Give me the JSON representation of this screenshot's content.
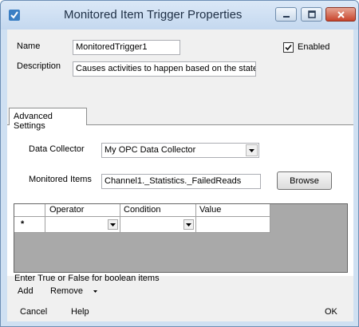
{
  "window": {
    "title": "Monitored Item Trigger Properties"
  },
  "form": {
    "name_label": "Name",
    "name_value": "MonitoredTrigger1",
    "enabled_label": "Enabled",
    "enabled_checked": true,
    "description_label": "Description",
    "description_value": "Causes activities to happen based on the state of a"
  },
  "tabs": [
    {
      "label": "Advanced Settings",
      "selected": true
    }
  ],
  "advanced": {
    "data_collector_label": "Data Collector",
    "data_collector_value": "My OPC Data Collector",
    "monitored_items_label": "Monitored Items",
    "monitored_items_value": "Channel1._Statistics._FailedReads",
    "browse_label": "Browse"
  },
  "grid": {
    "columns": [
      "Operator",
      "Condition",
      "Value"
    ],
    "new_row_marker": "*"
  },
  "hint": "Enter True or False for boolean items",
  "toolbar": {
    "add_label": "Add",
    "remove_label": "Remove"
  },
  "footer": {
    "cancel_label": "Cancel",
    "help_label": "Help",
    "ok_label": "OK"
  }
}
